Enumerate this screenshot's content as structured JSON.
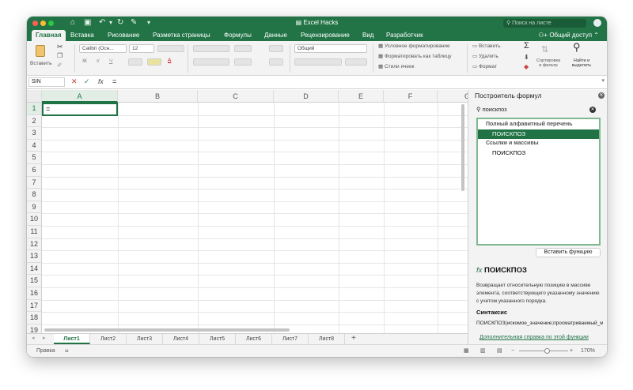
{
  "window": {
    "title": "Excel Hacks",
    "search_placeholder": "Поиск на листе"
  },
  "ribbon_tabs": [
    {
      "label": "Главная",
      "active": true
    },
    {
      "label": "Вставка"
    },
    {
      "label": "Рисование"
    },
    {
      "label": "Разметка страницы"
    },
    {
      "label": "Формулы"
    },
    {
      "label": "Данные"
    },
    {
      "label": "Рецензирование"
    },
    {
      "label": "Вид"
    },
    {
      "label": "Разработчик"
    }
  ],
  "share_label": "Общий доступ",
  "ribbon": {
    "paste_label": "Вставить",
    "font_name": "Calibri (Осн...",
    "font_size": "12",
    "number_format": "Общий",
    "cond_format": "Условное форматирование",
    "format_table": "Форматировать как таблицу",
    "cell_styles": "Стили ячеек",
    "insert_cells": "Вставить",
    "delete_cells": "Удалить",
    "format_cells": "Формат",
    "sort_filter": "Сортировка и фильтр",
    "find_select": "Найти и выделить"
  },
  "formula_bar": {
    "name_box": "SIN",
    "formula": "="
  },
  "active_cell": {
    "ref": "A1",
    "value": "="
  },
  "columns": [
    "A",
    "B",
    "C",
    "D",
    "E",
    "F",
    "G"
  ],
  "rows": [
    "1",
    "2",
    "3",
    "4",
    "5",
    "6",
    "7",
    "8",
    "9",
    "10",
    "11",
    "12",
    "13",
    "14",
    "15",
    "16",
    "17",
    "18",
    "19"
  ],
  "sheet_tabs": [
    "Лист1",
    "Лист2",
    "Лист3",
    "Лист4",
    "Лист5",
    "Лист6",
    "Лист7",
    "Лист8"
  ],
  "active_sheet": "Лист1",
  "status": {
    "mode": "Правка",
    "zoom": "170%"
  },
  "formula_builder": {
    "title": "Построитель формул",
    "search_value": "поискпоз",
    "list": [
      {
        "text": "Полный алфавитный перечень",
        "kind": "category"
      },
      {
        "text": "ПОИСКПОЗ",
        "kind": "item",
        "selected": true
      },
      {
        "text": "Ссылки и массивы",
        "kind": "category"
      },
      {
        "text": "ПОИСКПОЗ",
        "kind": "item"
      }
    ],
    "insert_button": "Вставить функцию",
    "fn_icon": "fx",
    "fn_name": "ПОИСКПОЗ",
    "description": "Возвращает относительную позицию в массиве элемента, соответствующего указанному значению с учетом указанного порядка.",
    "syntax_heading": "Синтаксис",
    "syntax": "ПОИСКПОЗ(искомое_значение;просматриваемый_массив;тип_сопоставления)",
    "help_link": "Дополнительная справка по этой функции"
  },
  "colors": {
    "accent": "#227447",
    "selected_row": "#217346"
  }
}
